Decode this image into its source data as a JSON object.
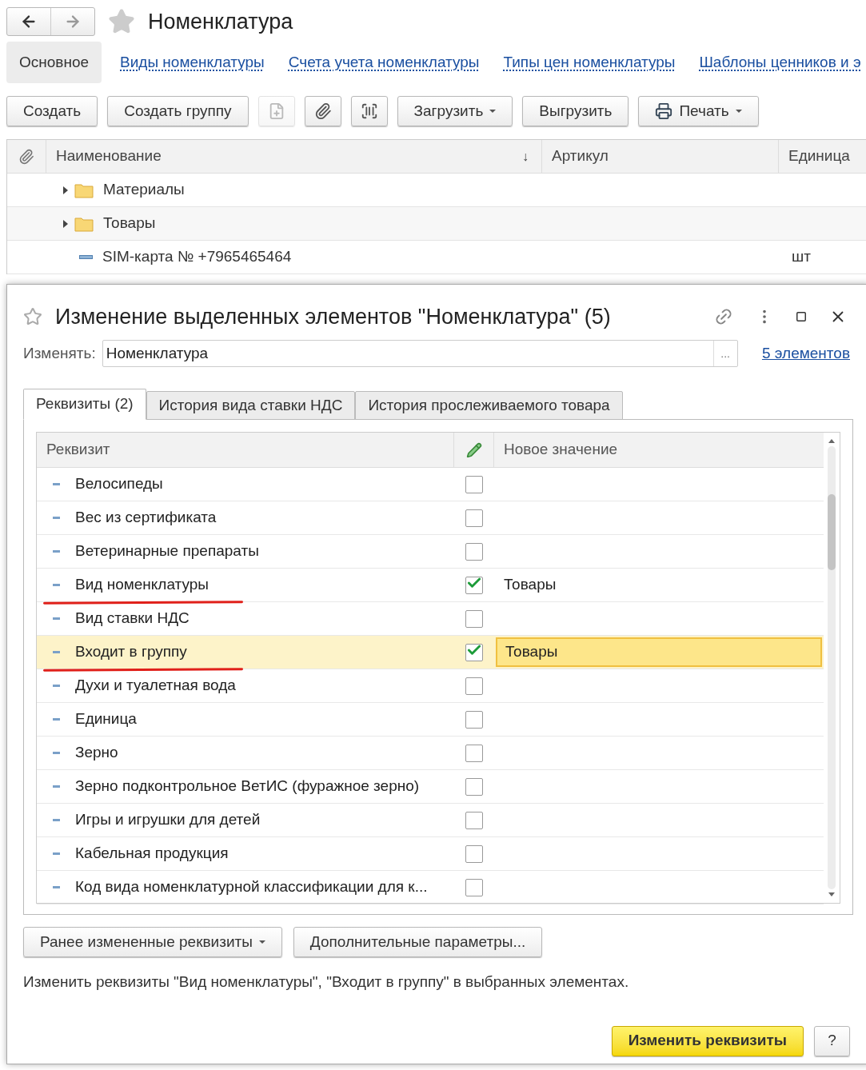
{
  "page": {
    "title": "Номенклатура"
  },
  "nav_tabs": [
    {
      "label": "Основное",
      "selected": true
    },
    {
      "label": "Виды номенклатуры",
      "selected": false
    },
    {
      "label": "Счета учета номенклатуры",
      "selected": false
    },
    {
      "label": "Типы цен номенклатуры",
      "selected": false
    },
    {
      "label": "Шаблоны ценников и э",
      "selected": false
    }
  ],
  "toolbar": [
    {
      "kind": "text",
      "label": "Создать"
    },
    {
      "kind": "text",
      "label": "Создать группу"
    },
    {
      "kind": "icon",
      "disabled": true
    },
    {
      "kind": "icon",
      "disabled": false
    },
    {
      "kind": "icon",
      "disabled": false
    },
    {
      "kind": "menu",
      "label": "Загрузить"
    },
    {
      "kind": "text",
      "label": "Выгрузить"
    },
    {
      "kind": "print",
      "label": "Печать"
    }
  ],
  "list": {
    "sort_mark": "↓",
    "columns": [
      "Наименование",
      "Артикул",
      "Единица"
    ],
    "rows": [
      {
        "kind": "folder",
        "name": "Материалы",
        "unit": ""
      },
      {
        "kind": "folder",
        "name": "Товары",
        "unit": ""
      },
      {
        "kind": "item",
        "name": "SIM-карта № +7965465464",
        "unit": "шт"
      }
    ]
  },
  "dialog": {
    "title": "Изменение выделенных элементов \"Номенклатура\" (5)",
    "change_label": "Изменять:",
    "change_value": "Номенклатура",
    "choose_button": "...",
    "count_link": "5 элементов",
    "tabs": [
      {
        "label": "Реквизиты (2)",
        "selected": true
      },
      {
        "label": "История вида ставки НДС",
        "selected": false
      },
      {
        "label": "История прослеживаемого товара",
        "selected": false
      }
    ],
    "table": {
      "columns": [
        "Реквизит",
        "Новое значение"
      ],
      "rows": [
        {
          "name": "Велосипеды",
          "checked": false,
          "value": "",
          "selected": false,
          "underlined": false
        },
        {
          "name": "Вес из сертификата",
          "checked": false,
          "value": "",
          "selected": false,
          "underlined": false
        },
        {
          "name": "Ветеринарные препараты",
          "checked": false,
          "value": "",
          "selected": false,
          "underlined": false
        },
        {
          "name": "Вид номенклатуры",
          "checked": true,
          "value": "Товары",
          "selected": false,
          "underlined": true
        },
        {
          "name": "Вид ставки НДС",
          "checked": false,
          "value": "",
          "selected": false,
          "underlined": false
        },
        {
          "name": "Входит в группу",
          "checked": true,
          "value": "Товары",
          "selected": true,
          "underlined": true
        },
        {
          "name": "Духи и туалетная вода",
          "checked": false,
          "value": "",
          "selected": false,
          "underlined": false
        },
        {
          "name": "Единица",
          "checked": false,
          "value": "",
          "selected": false,
          "underlined": false
        },
        {
          "name": "Зерно",
          "checked": false,
          "value": "",
          "selected": false,
          "underlined": false
        },
        {
          "name": "Зерно подконтрольное ВетИС (фуражное зерно)",
          "checked": false,
          "value": "",
          "selected": false,
          "underlined": false
        },
        {
          "name": "Игры и игрушки для детей",
          "checked": false,
          "value": "",
          "selected": false,
          "underlined": false
        },
        {
          "name": "Кабельная продукция",
          "checked": false,
          "value": "",
          "selected": false,
          "underlined": false
        },
        {
          "name": "Код вида номенклатурной классификации для к...",
          "checked": false,
          "value": "",
          "selected": false,
          "underlined": false
        }
      ]
    },
    "buttons": [
      {
        "kind": "menu",
        "label": "Ранее измененные реквизиты"
      },
      {
        "kind": "text",
        "label": "Дополнительные параметры..."
      }
    ],
    "info": "Изменить реквизиты \"Вид номенклатуры\", \"Входит в группу\" в выбранных элементах.",
    "primary_button": "Изменить реквизиты",
    "help_button": "?"
  }
}
